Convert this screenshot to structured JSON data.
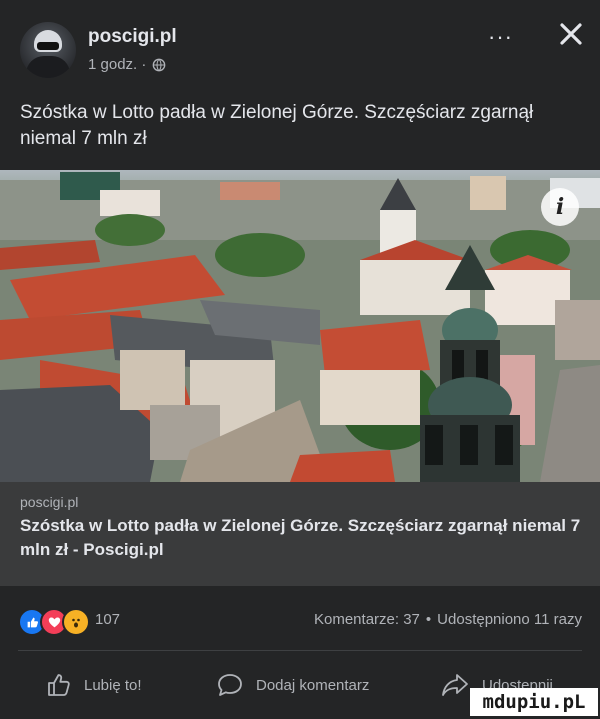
{
  "post": {
    "page_name": "poscigi.pl",
    "time": "1 godz. ·",
    "caption": "Szóstka w Lotto padła w Zielonej Górze. Szczęściarz zgarnął niemal 7 mln zł"
  },
  "header": {
    "more_glyph": "···",
    "privacy_icon": "globe-icon",
    "close_icon": "close-icon"
  },
  "link_preview": {
    "domain": "poscigi.pl",
    "title": "Szóstka w Lotto padła w Zielonej Górze. Szczęściarz zgarnął niemal 7 mln zł - Poscigi.pl",
    "info_glyph": "i"
  },
  "stats": {
    "reactions": [
      "like",
      "love",
      "wow"
    ],
    "reaction_count": "107",
    "comments": "Komentarze: 37",
    "dot": "•",
    "shares": "Udostępniono 11 razy"
  },
  "actions": {
    "like_label": "Lubię to!",
    "comment_label": "Dodaj komentarz",
    "share_label": "Udostępnij"
  },
  "watermark": {
    "text": "mdupiu.pL"
  },
  "colors": {
    "background": "#242526",
    "link_box": "#3a3b3c",
    "like_blue": "#1877f2",
    "love_red": "#f33e58",
    "wow_yellow": "#f7b125"
  }
}
